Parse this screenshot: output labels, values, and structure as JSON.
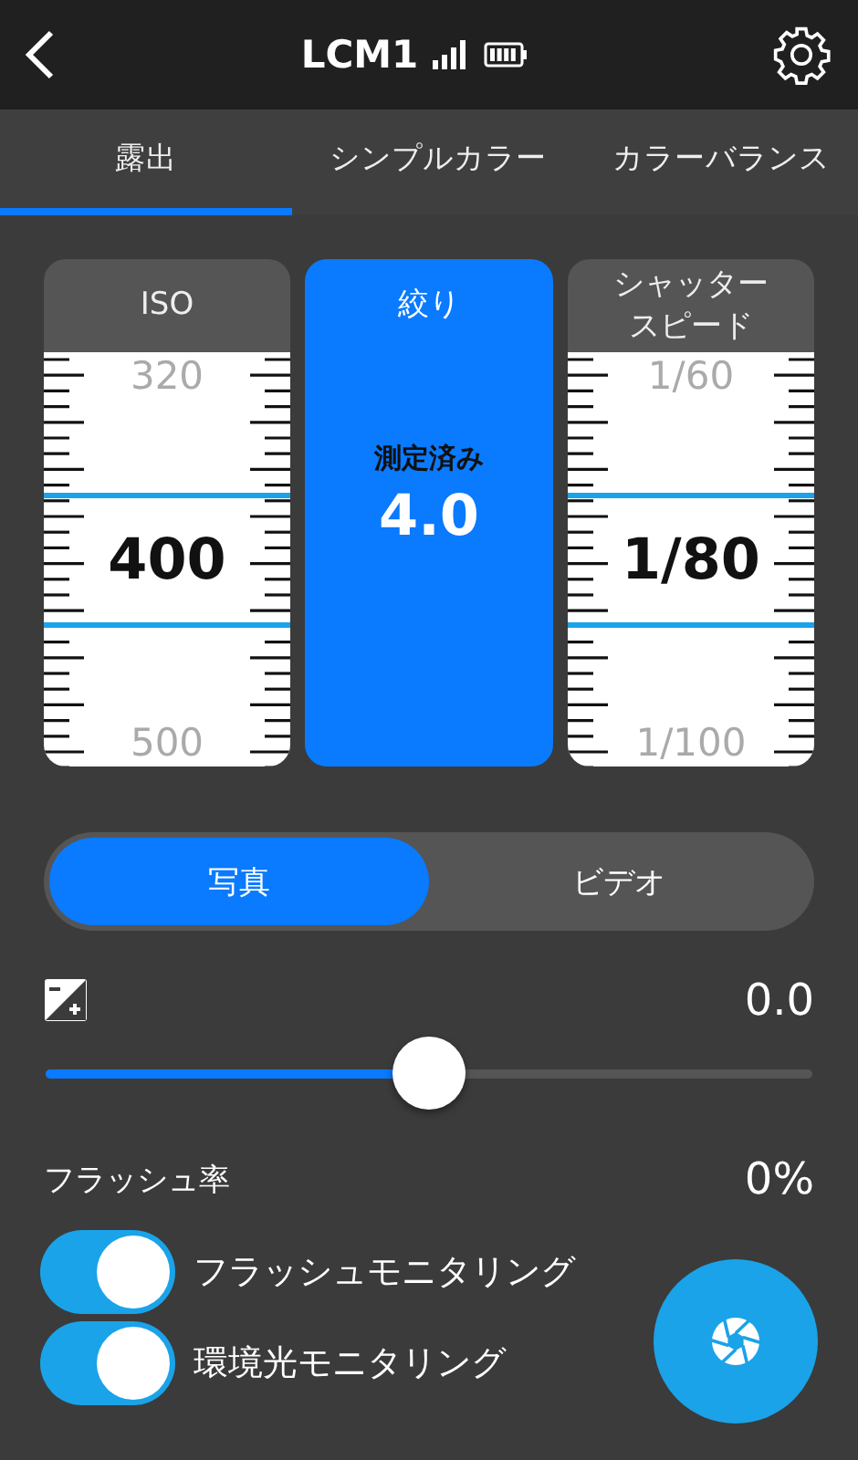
{
  "header": {
    "title": "LCM1"
  },
  "tabs": [
    {
      "label": "露出",
      "selected": true
    },
    {
      "label": "シンプルカラー",
      "selected": false
    },
    {
      "label": "カラーバランス",
      "selected": false
    }
  ],
  "dials": [
    {
      "kind": "scale",
      "label": "ISO",
      "prev": "320",
      "value": "400",
      "next": "500"
    },
    {
      "kind": "fixed",
      "label": "絞り",
      "status": "測定済み",
      "value": "4.0"
    },
    {
      "kind": "scale",
      "label": "シャッタースピード",
      "prev": "1/60",
      "value": "1/80",
      "next": "1/100"
    }
  ],
  "mode": [
    {
      "label": "写真",
      "selected": true
    },
    {
      "label": "ビデオ",
      "selected": false
    }
  ],
  "exposure": {
    "value": "0.0",
    "level": 0.5
  },
  "flash": {
    "label": "フラッシュ率",
    "value": "0%"
  },
  "toggles": [
    {
      "label": "フラッシュモニタリング",
      "on": true
    },
    {
      "label": "環境光モニタリング",
      "on": true
    }
  ]
}
